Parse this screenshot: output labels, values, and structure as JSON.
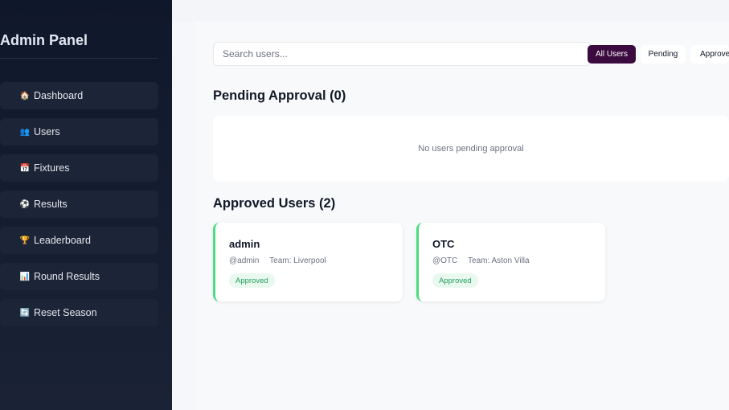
{
  "sidebar": {
    "title": "Admin Panel",
    "items": [
      {
        "label": "Dashboard",
        "icon": "🏠"
      },
      {
        "label": "Users",
        "icon": "👥"
      },
      {
        "label": "Fixtures",
        "icon": "📅"
      },
      {
        "label": "Results",
        "icon": "⚽"
      },
      {
        "label": "Leaderboard",
        "icon": "🏆"
      },
      {
        "label": "Round Results",
        "icon": "📊"
      },
      {
        "label": "Reset Season",
        "icon": "🔄"
      }
    ]
  },
  "search": {
    "placeholder": "Search users...",
    "value": ""
  },
  "filters": [
    {
      "label": "All Users",
      "active": true
    },
    {
      "label": "Pending",
      "active": false
    },
    {
      "label": "Approved",
      "active": false
    }
  ],
  "pending": {
    "title": "Pending Approval (0)",
    "empty_text": "No users pending approval"
  },
  "approved": {
    "title": "Approved Users (2)",
    "users": [
      {
        "name": "admin",
        "handle": "@admin",
        "team": "Team: Liverpool",
        "status": "Approved"
      },
      {
        "name": "OTC",
        "handle": "@OTC",
        "team": "Team: Aston Villa",
        "status": "Approved"
      }
    ]
  },
  "colors": {
    "sidebar_bg": "#0f172a",
    "accent": "#3b0a3f",
    "approved_green": "#4ade80"
  }
}
